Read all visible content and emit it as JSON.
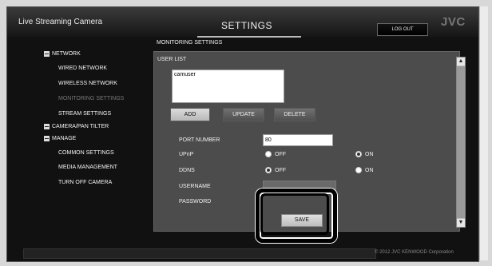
{
  "header": {
    "app_title": "Live Streaming Camera",
    "page_title": "SETTINGS",
    "logout_label": "LOG OUT",
    "logo_text": "JVC"
  },
  "menu": {
    "network_group": "NETWORK",
    "wired_network": "WIRED NETWORK",
    "wireless_network": "WIRELESS NETWORK",
    "monitoring_settings": "MONITORING SETTINGS",
    "stream_settings": "STREAM SETTINGS",
    "camera_pan_tilter": "CAMERA/PAN TILTER",
    "manage_group": "MANAGE",
    "common_settings": "COMMON SETTINGS",
    "media_management": "MEDIA MANAGEMENT",
    "turn_off_camera": "TURN OFF CAMERA"
  },
  "content": {
    "section_title": "MONITORING SETTINGS",
    "user_list_label": "USER LIST",
    "users": [
      "camuser"
    ],
    "buttons": {
      "add": "ADD",
      "update": "UPDATE",
      "delete": "DELETE",
      "save": "SAVE"
    },
    "port_number_label": "PORT NUMBER",
    "port_number_value": "80",
    "upnp_label": "UPnP",
    "ddns_label": "DDNS",
    "off_label": "OFF",
    "on_label": "ON",
    "upnp_selected": "ON",
    "ddns_selected": "OFF",
    "username_label": "USERNAME",
    "password_label": "PASSWORD",
    "username_value": ""
  },
  "footer": {
    "copyright": "© 2012 JVC KENWOOD Corporation"
  },
  "colors": {
    "background": "#111111",
    "panel": "#4c4c4c",
    "accent_highlight": "#000000"
  }
}
